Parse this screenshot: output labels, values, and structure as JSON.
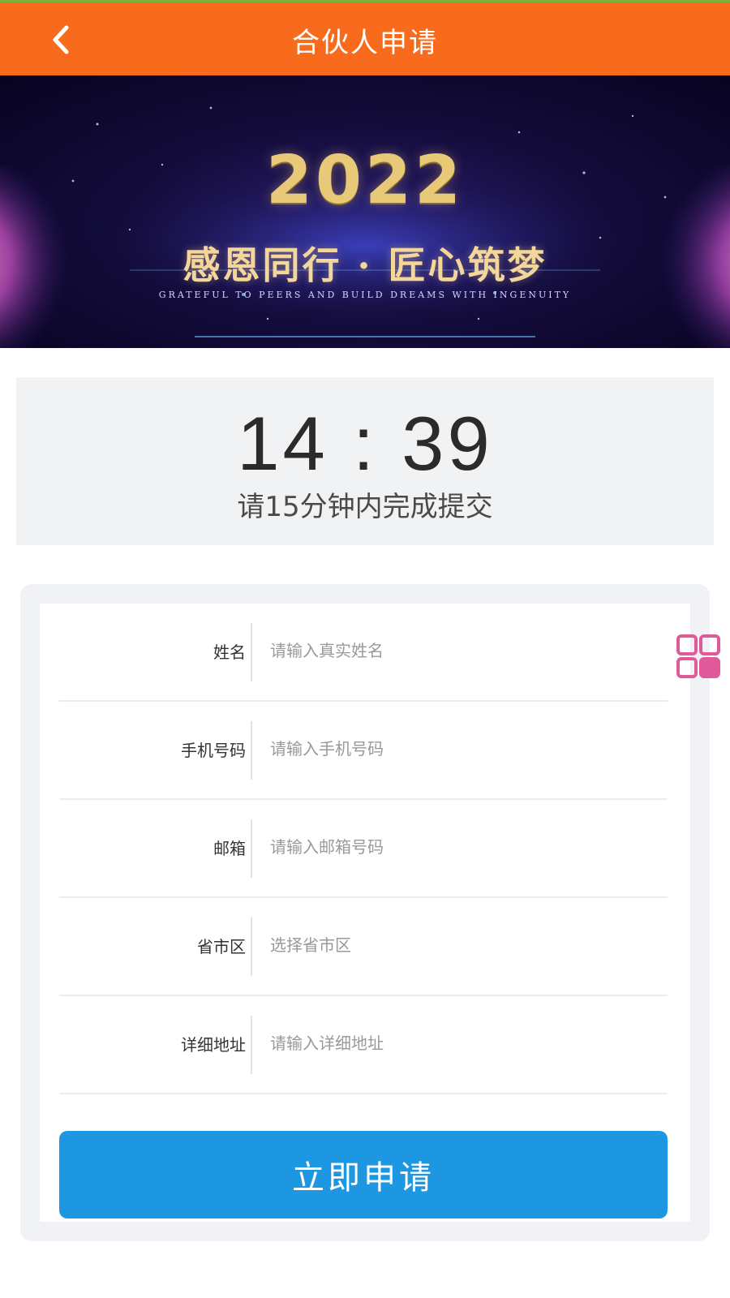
{
  "header": {
    "title": "合伙人申请",
    "back_icon": "chevron-left-icon",
    "color": "#f86a1c"
  },
  "banner": {
    "year": "2022",
    "slogan": "感恩同行 · 匠心筑梦",
    "slogan_en": "GRATEFUL TO PEERS AND BUILD DREAMS WITH INGENUITY"
  },
  "timer": {
    "countdown": "14 : 39",
    "hint": "请15分钟内完成提交"
  },
  "form": {
    "fields": [
      {
        "label": "姓名",
        "placeholder": "请输入真实姓名"
      },
      {
        "label": "手机号码",
        "placeholder": "请输入手机号码"
      },
      {
        "label": "邮箱",
        "placeholder": "请输入邮箱号码"
      },
      {
        "label": "省市区",
        "placeholder": "选择省市区"
      },
      {
        "label": "详细地址",
        "placeholder": "请输入详细地址"
      }
    ],
    "submit_label": "立即申请",
    "submit_color": "#1d97e1"
  },
  "floating_button": {
    "icon": "grid-icon",
    "color": "#e05a9a"
  }
}
